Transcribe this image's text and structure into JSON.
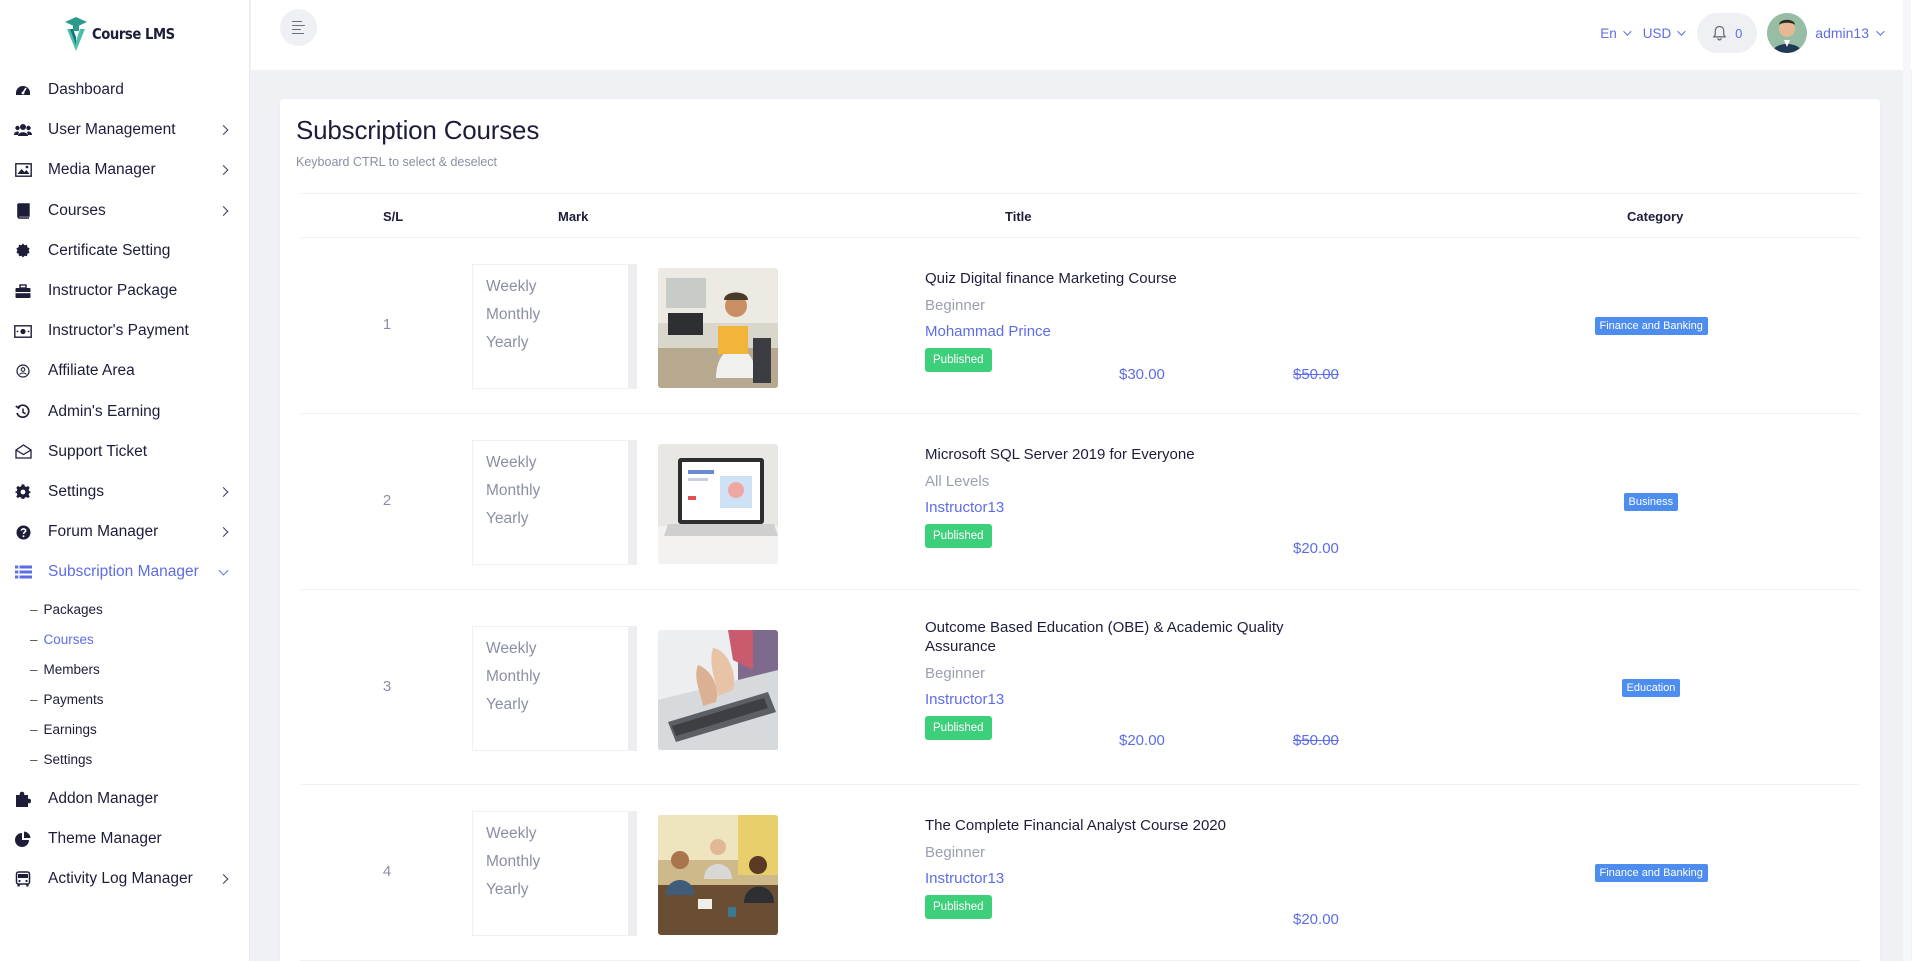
{
  "app": {
    "logo_text": "Course LMS"
  },
  "sidebar": {
    "items": [
      {
        "label": "Dashboard",
        "icon": "dashboard-icon",
        "has_chevron": false
      },
      {
        "label": "User Management",
        "icon": "users-icon",
        "has_chevron": true
      },
      {
        "label": "Media Manager",
        "icon": "image-icon",
        "has_chevron": true
      },
      {
        "label": "Courses",
        "icon": "book-icon",
        "has_chevron": true
      },
      {
        "label": "Certificate Setting",
        "icon": "certificate-icon",
        "has_chevron": false
      },
      {
        "label": "Instructor Package",
        "icon": "briefcase-icon",
        "has_chevron": false
      },
      {
        "label": "Instructor's Payment",
        "icon": "money-icon",
        "has_chevron": false
      },
      {
        "label": "Affiliate Area",
        "icon": "affiliate-icon",
        "has_chevron": false
      },
      {
        "label": "Admin's Earning",
        "icon": "history-icon",
        "has_chevron": false
      },
      {
        "label": "Support Ticket",
        "icon": "envelope-icon",
        "has_chevron": false
      },
      {
        "label": "Settings",
        "icon": "gear-icon",
        "has_chevron": true
      },
      {
        "label": "Forum Manager",
        "icon": "question-icon",
        "has_chevron": true
      },
      {
        "label": "Subscription Manager",
        "icon": "list-icon",
        "has_chevron": true,
        "active": true
      }
    ],
    "sub_items": [
      {
        "label": "Packages"
      },
      {
        "label": "Courses",
        "active": true
      },
      {
        "label": "Members"
      },
      {
        "label": "Payments"
      },
      {
        "label": "Earnings"
      },
      {
        "label": "Settings"
      }
    ],
    "bottom_items": [
      {
        "label": "Addon Manager",
        "icon": "puzzle-icon",
        "has_chevron": false
      },
      {
        "label": "Theme Manager",
        "icon": "pie-chart-icon",
        "has_chevron": false
      },
      {
        "label": "Activity Log Manager",
        "icon": "bus-icon",
        "has_chevron": true
      }
    ]
  },
  "header": {
    "language": "En",
    "currency": "USD",
    "notifications_count": "0",
    "username": "admin13"
  },
  "page": {
    "title": "Subscription Courses",
    "hint": "Keyboard CTRL to select & deselect",
    "columns": {
      "sl": "S/L",
      "mark": "Mark",
      "title": "Title",
      "category": "Category"
    }
  },
  "plans": [
    "Weekly",
    "Monthly",
    "Yearly"
  ],
  "courses": [
    {
      "sl": "1",
      "title": "Quiz Digital finance Marketing Course",
      "level": "Beginner",
      "instructor": "Mohammad Prince",
      "status": "Published",
      "price": "$30.00",
      "old_price": "$50.00",
      "category": "Finance and Banking"
    },
    {
      "sl": "2",
      "title": "Microsoft SQL Server 2019 for Everyone",
      "level": "All Levels",
      "instructor": "Instructor13",
      "status": "Published",
      "price": "",
      "old_price": "",
      "single_price": "$20.00",
      "category": "Business"
    },
    {
      "sl": "3",
      "title": "Outcome Based Education (OBE) & Academic Quality Assurance",
      "level": "Beginner",
      "instructor": "Instructor13",
      "status": "Published",
      "price": "$20.00",
      "old_price": "$50.00",
      "category": "Education"
    },
    {
      "sl": "4",
      "title": "The Complete Financial Analyst Course 2020",
      "level": "Beginner",
      "instructor": "Instructor13",
      "status": "Published",
      "price": "",
      "old_price": "",
      "single_price": "$20.00",
      "category": "Finance and Banking"
    }
  ],
  "colors": {
    "accent": "#5d6de6",
    "published": "#3ecf7b",
    "badge": "#4d8df0",
    "muted": "#8a8fa3"
  }
}
